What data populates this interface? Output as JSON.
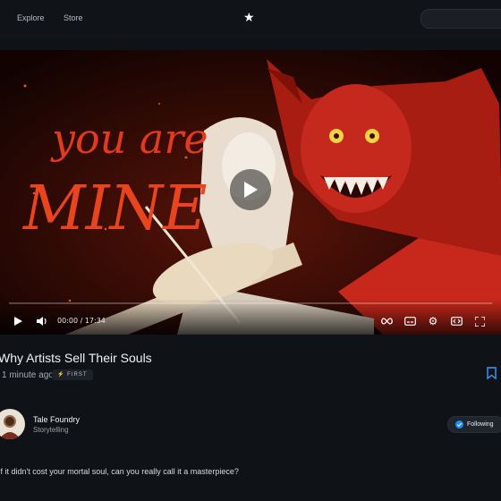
{
  "nav": {
    "explore": "Explore",
    "store": "Store",
    "search_placeholder": ""
  },
  "video": {
    "art_text_top": "you are",
    "art_text_bottom": "MINE",
    "time_label": "00:00 / 17:34",
    "progress": 0
  },
  "post": {
    "title": "Why Artists Sell Their Souls",
    "age": "1 minute ago",
    "badge": "FIRST"
  },
  "channel": {
    "name": "Tale Foundry",
    "category": "Storytelling",
    "follow_label": "Following"
  },
  "description": "If it didn't cost your mortal soul, can you really call it a masterpiece?",
  "colors": {
    "accent": "#1a8cff",
    "background": "#0f1216",
    "thumb_red": "#c8281b"
  },
  "icons": [
    "star-logo-icon",
    "play-icon",
    "volume-icon",
    "loop-icon",
    "captions-icon",
    "gear-icon",
    "embed-icon",
    "fullscreen-icon",
    "bookmark-icon",
    "check-badge-icon"
  ]
}
